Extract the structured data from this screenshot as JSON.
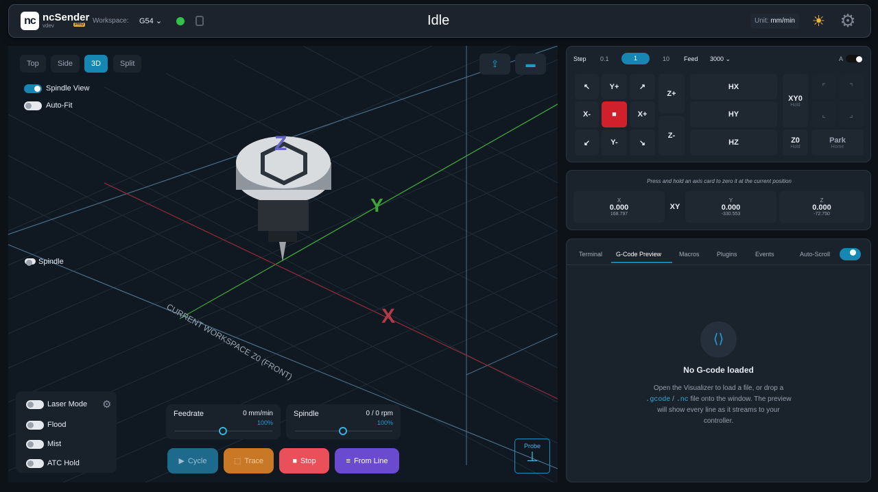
{
  "header": {
    "brand": "ncSender",
    "version": "vdev",
    "pro": "PRO",
    "workspace_label": "Workspace:",
    "workspace_value": "G54",
    "status": "Idle",
    "unit_label": "Unit:",
    "unit_value": "mm/min",
    "logo": "nc"
  },
  "visualizer": {
    "views": [
      "Top",
      "Side",
      "3D",
      "Split"
    ],
    "active_view": "3D",
    "spindle_view": "Spindle View",
    "auto_fit": "Auto-Fit",
    "spindle": "Spindle",
    "axis_z": "Z",
    "axis_y": "Y",
    "axis_x": "X",
    "workspace_text": "CURRENT WORKSPACE Z0 (FRONT)"
  },
  "coolant": {
    "laser_mode": "Laser Mode",
    "flood": "Flood",
    "mist": "Mist",
    "atc_hold": "ATC Hold"
  },
  "feedrate": {
    "label": "Feedrate",
    "value": "0 mm/min",
    "percent": "100%"
  },
  "spindle": {
    "label": "Spindle",
    "value": "0 / 0 rpm",
    "percent": "100%"
  },
  "actions": {
    "cycle": "Cycle",
    "trace": "Trace",
    "stop": "Stop",
    "from_line": "From Line",
    "probe": "Probe"
  },
  "jog": {
    "step_label": "Step",
    "steps": [
      "0.1",
      "1",
      "10"
    ],
    "active_step": "1",
    "feed_label": "Feed",
    "feed_value": "3000",
    "a_label": "A",
    "yplus": "Y+",
    "xminus": "X-",
    "xplus": "X+",
    "yminus": "Y-",
    "zplus": "Z+",
    "zminus": "Z-",
    "hx": "HX",
    "hy": "HY",
    "hz": "HZ",
    "xy0": "XY0",
    "xy0_sub": "Hold",
    "z0": "Z0",
    "z0_sub": "Hold",
    "park": "Park",
    "park_sub": "Home"
  },
  "position": {
    "hint": "Press and hold an axis card to zero it at the current position",
    "x_label": "X",
    "x_value": "0.000",
    "x_machine": "168.797",
    "xy_label": "XY",
    "y_label": "Y",
    "y_value": "0.000",
    "y_machine": "-330.553",
    "z_label": "Z",
    "z_value": "0.000",
    "z_machine": "-72.750"
  },
  "tabs": {
    "items": [
      "Terminal",
      "G-Code Preview",
      "Macros",
      "Plugins",
      "Events"
    ],
    "active": "G-Code Preview",
    "auto_scroll": "Auto-Scroll"
  },
  "gcode": {
    "title": "No G-code loaded",
    "line1": "Open the Visualizer to load a file, or drop a",
    "ext1": ".gcode",
    "slash": "/",
    "ext2": ".nc",
    "line1b": "file onto the window. The preview",
    "line2": "will show every line as it streams to your",
    "line3": "controller."
  },
  "colors": {
    "accent": "#1686b3",
    "stop": "#e9505a",
    "trace": "#c97925",
    "cycle": "#1e6a8c",
    "from_line": "#6a4bd0"
  }
}
